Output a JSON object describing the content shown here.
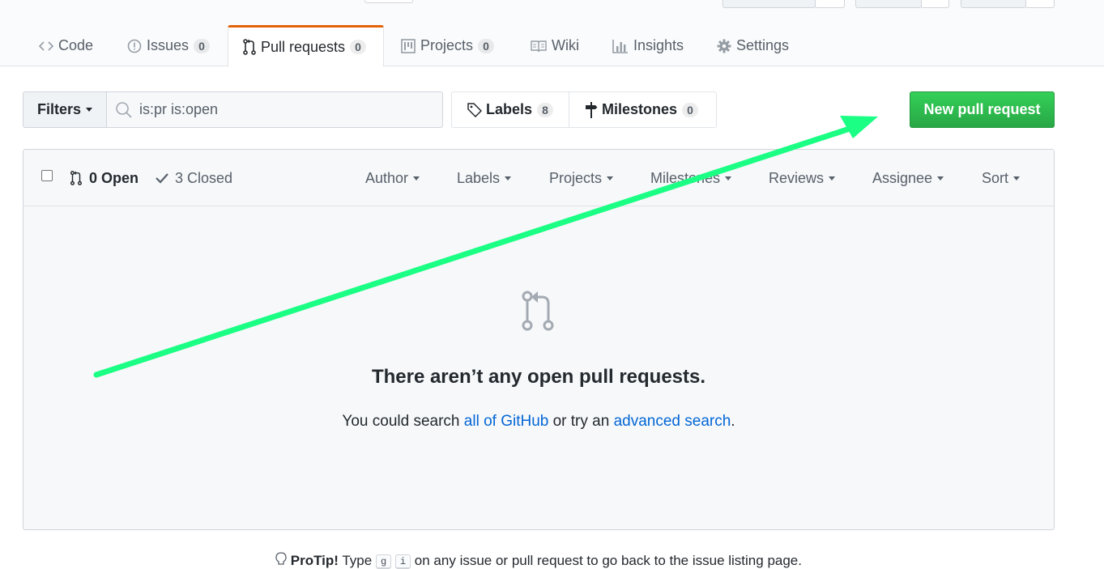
{
  "top_buttons": [
    {
      "name": "watch-button"
    },
    {
      "name": "star-button"
    },
    {
      "name": "fork-button"
    }
  ],
  "tabs": [
    {
      "id": "code",
      "label": "Code",
      "icon": "code-icon",
      "counter": null
    },
    {
      "id": "issues",
      "label": "Issues",
      "icon": "issue-opened-icon",
      "counter": "0"
    },
    {
      "id": "pulls",
      "label": "Pull requests",
      "icon": "git-pull-request-icon",
      "counter": "0",
      "selected": true
    },
    {
      "id": "projects",
      "label": "Projects",
      "icon": "project-icon",
      "counter": "0"
    },
    {
      "id": "wiki",
      "label": "Wiki",
      "icon": "book-icon",
      "counter": null
    },
    {
      "id": "insights",
      "label": "Insights",
      "icon": "graph-icon",
      "counter": null
    },
    {
      "id": "settings",
      "label": "Settings",
      "icon": "gear-icon",
      "counter": null
    }
  ],
  "filters": {
    "button_label": "Filters",
    "search_value": "is:pr is:open",
    "search_icon": "search-icon"
  },
  "labels_milestones": {
    "labels_label": "Labels",
    "labels_count": "8",
    "milestones_label": "Milestones",
    "milestones_count": "0"
  },
  "new_pr_label": "New pull request",
  "list_header": {
    "open_label": "0 Open",
    "closed_label": "3 Closed",
    "filters": [
      "Author",
      "Labels",
      "Projects",
      "Milestones",
      "Reviews",
      "Assignee",
      "Sort"
    ]
  },
  "blankslate": {
    "icon": "git-pull-request-icon",
    "title": "There aren’t any open pull requests.",
    "text_before": "You could search ",
    "link1": "all of GitHub",
    "text_middle": " or try an ",
    "link2": "advanced search",
    "text_after": "."
  },
  "protip": {
    "icon": "light-bulb-icon",
    "strong": "ProTip!",
    "text_before": " Type ",
    "key1": "g",
    "key2": "i",
    "text_after": " on any issue or pull request to go back to the issue listing page."
  },
  "annotation": {
    "color": "#1aff84",
    "icon": "annotation-arrow"
  }
}
